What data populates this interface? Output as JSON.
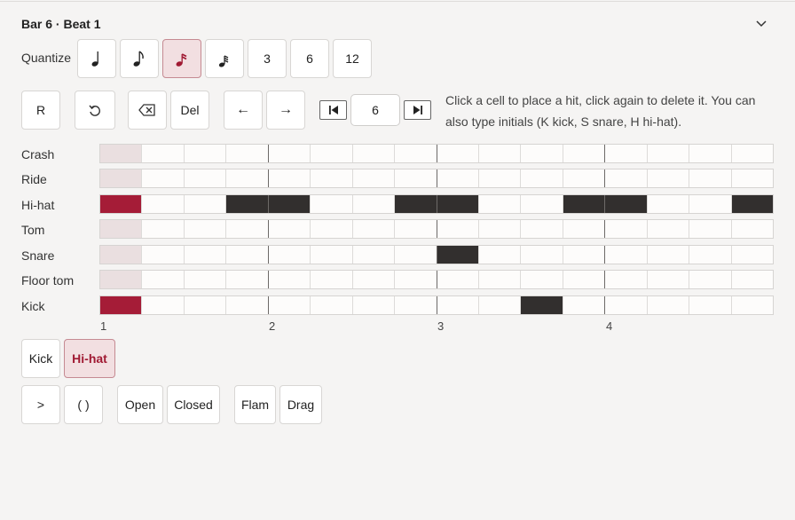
{
  "header": {
    "title": "Bar 6 · Beat 1"
  },
  "quantize": {
    "label": "Quantize",
    "options": [
      {
        "kind": "quarter-note-icon",
        "selected": false
      },
      {
        "kind": "eighth-note-icon",
        "selected": false
      },
      {
        "kind": "sixteenth-note-icon",
        "selected": true
      },
      {
        "kind": "thirty-second-note-icon",
        "selected": false
      },
      {
        "label": "3",
        "selected": false
      },
      {
        "label": "6",
        "selected": false
      },
      {
        "label": "12",
        "selected": false
      }
    ]
  },
  "toolbar": {
    "rest_label": "R",
    "undo_icon": "undo-icon",
    "backspace_icon": "backspace-icon",
    "delete_label": "Del",
    "left_arrow": "←",
    "right_arrow": "→",
    "bar_value": "6",
    "hint": "Click a cell to place a hit, click again to delete it. You can also type initials (K kick, S snare, H hi-hat)."
  },
  "grid": {
    "steps": 16,
    "steps_per_beat": 4,
    "beat_labels": [
      "1",
      "2",
      "3",
      "4"
    ],
    "rows": [
      {
        "name": "Crash",
        "hits": []
      },
      {
        "name": "Ride",
        "hits": []
      },
      {
        "name": "Hi-hat",
        "hits": [
          0,
          3,
          4,
          7,
          8,
          11,
          12,
          15
        ]
      },
      {
        "name": "Tom",
        "hits": []
      },
      {
        "name": "Snare",
        "hits": [
          8
        ]
      },
      {
        "name": "Floor tom",
        "hits": []
      },
      {
        "name": "Kick",
        "hits": [
          0,
          10
        ]
      }
    ]
  },
  "instruments": {
    "kick_label": "Kick",
    "hihat_label": "Hi-hat",
    "selected": "Hi-hat"
  },
  "articulations": {
    "accent_label": ">",
    "ghost_label": "( )",
    "open_label": "Open",
    "closed_label": "Closed",
    "flam_label": "Flam",
    "drag_label": "Drag"
  },
  "colors": {
    "accent": "#a51c37",
    "hit": "#322f2e",
    "current_column": "#eadfe0",
    "selected_button_bg": "#f2dfe1"
  }
}
